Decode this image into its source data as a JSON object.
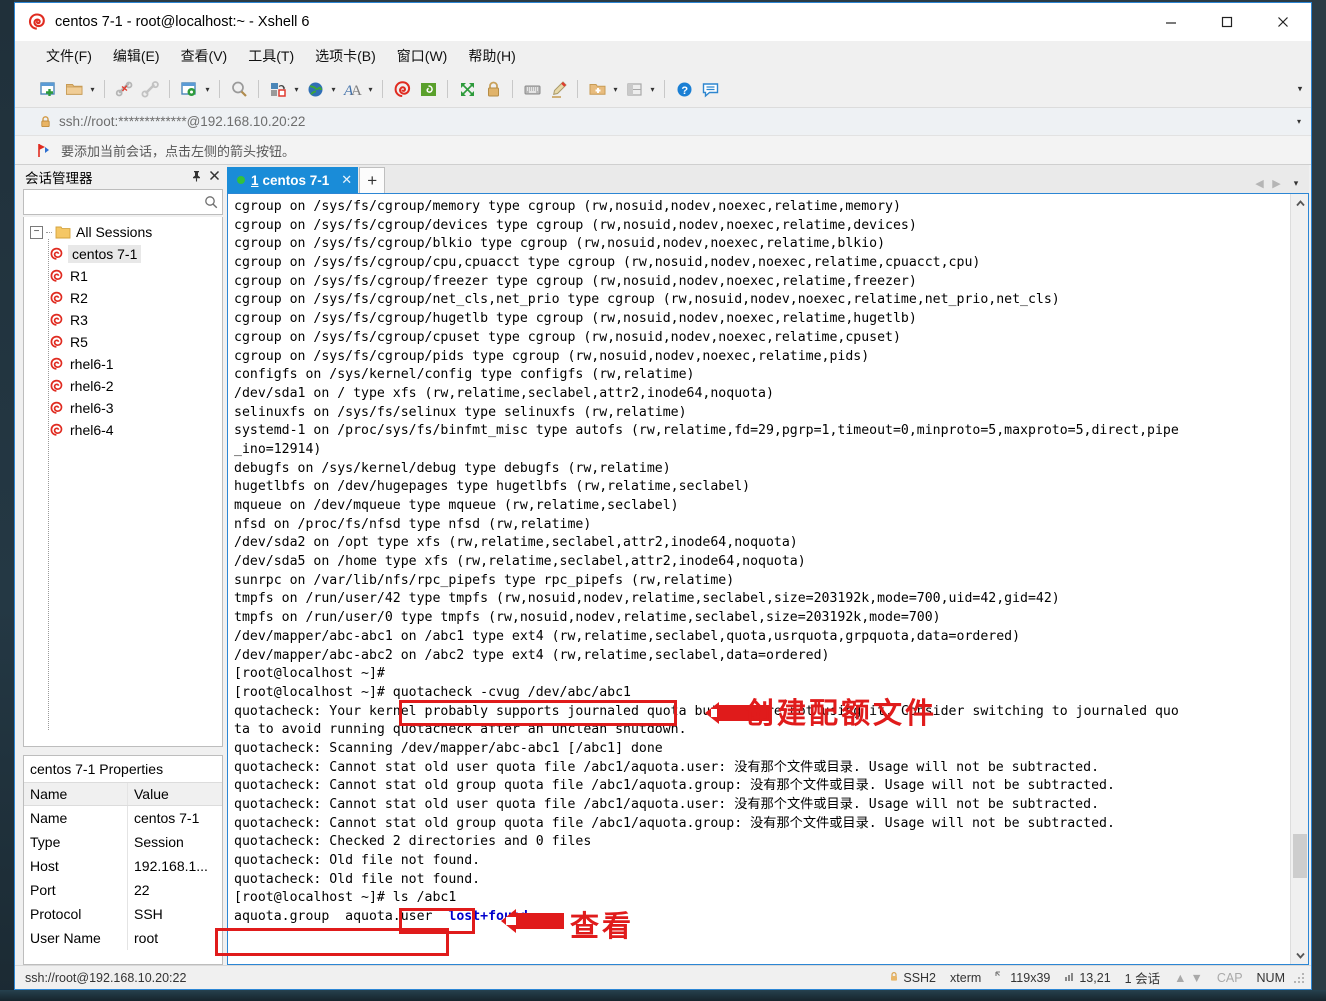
{
  "window": {
    "title": "centos 7-1 - root@localhost:~ - Xshell 6",
    "app_icon": "xshell-logo-icon",
    "minimize": "—",
    "maximize": "☐",
    "close": "✕"
  },
  "menubar": {
    "items": [
      {
        "label": "文件(F)",
        "name": "menu-file"
      },
      {
        "label": "编辑(E)",
        "name": "menu-edit"
      },
      {
        "label": "查看(V)",
        "name": "menu-view"
      },
      {
        "label": "工具(T)",
        "name": "menu-tools"
      },
      {
        "label": "选项卡(B)",
        "name": "menu-tabs"
      },
      {
        "label": "窗口(W)",
        "name": "menu-window"
      },
      {
        "label": "帮助(H)",
        "name": "menu-help"
      }
    ]
  },
  "toolbar": {
    "overflow_caret": "▾",
    "buttons": [
      {
        "name": "new-session-icon",
        "caret": false
      },
      {
        "name": "open-folder-icon",
        "caret": true
      },
      {
        "name": "disconnect-icon",
        "caret": false
      },
      {
        "name": "reconnect-icon",
        "caret": false
      },
      {
        "name": "session-properties-icon",
        "caret": true
      },
      {
        "name": "find-icon",
        "caret": false
      },
      {
        "name": "file-transfer-icon",
        "caret": true
      },
      {
        "name": "globe-icon",
        "caret": true
      },
      {
        "name": "font-icon",
        "caret": true
      },
      {
        "name": "xshell-icon",
        "caret": false
      },
      {
        "name": "xftp-icon",
        "caret": false
      },
      {
        "name": "fullscreen-icon",
        "caret": false
      },
      {
        "name": "lock-icon",
        "caret": false
      },
      {
        "name": "keyboard-icon",
        "caret": false
      },
      {
        "name": "highlight-pen-icon",
        "caret": false
      },
      {
        "name": "add-to-folder-icon",
        "caret": true
      },
      {
        "name": "arrange-layout-icon",
        "caret": true
      },
      {
        "name": "help-icon",
        "caret": false
      },
      {
        "name": "feedback-icon",
        "caret": false
      }
    ]
  },
  "addressbar": {
    "lock_icon": "lock-icon",
    "value": "ssh://root:*************@192.168.10.20:22",
    "caret": "▾"
  },
  "notifybar": {
    "icon": "bookmark-flag-icon",
    "text": "要添加当前会话，点击左侧的箭头按钮。"
  },
  "sidebar": {
    "title": "会话管理器",
    "pin_icon": "pin-icon",
    "close_icon": "close-icon",
    "search": {
      "value": "",
      "placeholder": "",
      "icon": "search-icon"
    },
    "root": {
      "label": "All Sessions",
      "expander": "−",
      "icon": "folder-icon"
    },
    "sessions": [
      {
        "label": "centos 7-1",
        "icon": "session-icon",
        "selected": true
      },
      {
        "label": "R1",
        "icon": "session-icon",
        "selected": false
      },
      {
        "label": "R2",
        "icon": "session-icon",
        "selected": false
      },
      {
        "label": "R3",
        "icon": "session-icon",
        "selected": false
      },
      {
        "label": "R5",
        "icon": "session-icon",
        "selected": false
      },
      {
        "label": "rhel6-1",
        "icon": "session-icon",
        "selected": false
      },
      {
        "label": "rhel6-2",
        "icon": "session-icon",
        "selected": false
      },
      {
        "label": "rhel6-3",
        "icon": "session-icon",
        "selected": false
      },
      {
        "label": "rhel6-4",
        "icon": "session-icon",
        "selected": false
      }
    ]
  },
  "properties": {
    "title": "centos 7-1 Properties",
    "headers": [
      "Name",
      "Value"
    ],
    "rows": [
      {
        "name": "Name",
        "value": "centos 7-1"
      },
      {
        "name": "Type",
        "value": "Session"
      },
      {
        "name": "Host",
        "value": "192.168.1..."
      },
      {
        "name": "Port",
        "value": "22"
      },
      {
        "name": "Protocol",
        "value": "SSH"
      },
      {
        "name": "User Name",
        "value": "root"
      }
    ]
  },
  "tabs": {
    "items": [
      {
        "number": "1",
        "label": "centos 7-1",
        "close": "✕",
        "status_dot": "#33c13d",
        "active": true
      }
    ],
    "add_label": "+",
    "nav_prev": "◀",
    "nav_next": "▶",
    "nav_menu": "▾"
  },
  "terminal": {
    "lines": [
      "cgroup on /sys/fs/cgroup/memory type cgroup (rw,nosuid,nodev,noexec,relatime,memory)",
      "cgroup on /sys/fs/cgroup/devices type cgroup (rw,nosuid,nodev,noexec,relatime,devices)",
      "cgroup on /sys/fs/cgroup/blkio type cgroup (rw,nosuid,nodev,noexec,relatime,blkio)",
      "cgroup on /sys/fs/cgroup/cpu,cpuacct type cgroup (rw,nosuid,nodev,noexec,relatime,cpuacct,cpu)",
      "cgroup on /sys/fs/cgroup/freezer type cgroup (rw,nosuid,nodev,noexec,relatime,freezer)",
      "cgroup on /sys/fs/cgroup/net_cls,net_prio type cgroup (rw,nosuid,nodev,noexec,relatime,net_prio,net_cls)",
      "cgroup on /sys/fs/cgroup/hugetlb type cgroup (rw,nosuid,nodev,noexec,relatime,hugetlb)",
      "cgroup on /sys/fs/cgroup/cpuset type cgroup (rw,nosuid,nodev,noexec,relatime,cpuset)",
      "cgroup on /sys/fs/cgroup/pids type cgroup (rw,nosuid,nodev,noexec,relatime,pids)",
      "configfs on /sys/kernel/config type configfs (rw,relatime)",
      "/dev/sda1 on / type xfs (rw,relatime,seclabel,attr2,inode64,noquota)",
      "selinuxfs on /sys/fs/selinux type selinuxfs (rw,relatime)",
      "systemd-1 on /proc/sys/fs/binfmt_misc type autofs (rw,relatime,fd=29,pgrp=1,timeout=0,minproto=5,maxproto=5,direct,pipe",
      "_ino=12914)",
      "debugfs on /sys/kernel/debug type debugfs (rw,relatime)",
      "hugetlbfs on /dev/hugepages type hugetlbfs (rw,relatime,seclabel)",
      "mqueue on /dev/mqueue type mqueue (rw,relatime,seclabel)",
      "nfsd on /proc/fs/nfsd type nfsd (rw,relatime)",
      "/dev/sda2 on /opt type xfs (rw,relatime,seclabel,attr2,inode64,noquota)",
      "/dev/sda5 on /home type xfs (rw,relatime,seclabel,attr2,inode64,noquota)",
      "sunrpc on /var/lib/nfs/rpc_pipefs type rpc_pipefs (rw,relatime)",
      "tmpfs on /run/user/42 type tmpfs (rw,nosuid,nodev,relatime,seclabel,size=203192k,mode=700,uid=42,gid=42)",
      "tmpfs on /run/user/0 type tmpfs (rw,nosuid,nodev,relatime,seclabel,size=203192k,mode=700)",
      "/dev/mapper/abc-abc1 on /abc1 type ext4 (rw,relatime,seclabel,quota,usrquota,grpquota,data=ordered)",
      "/dev/mapper/abc-abc2 on /abc2 type ext4 (rw,relatime,seclabel,data=ordered)",
      "[root@localhost ~]#",
      "[root@localhost ~]# quotacheck -cvug /dev/abc/abc1",
      "quotacheck: Your kernel probably supports journaled quota but you are not using it. Consider switching to journaled quo",
      "ta to avoid running quotacheck after an unclean shutdown.",
      "quotacheck: Scanning /dev/mapper/abc-abc1 [/abc1] done",
      "quotacheck: Cannot stat old user quota file /abc1/aquota.user: 没有那个文件或目录. Usage will not be subtracted.",
      "quotacheck: Cannot stat old group quota file /abc1/aquota.group: 没有那个文件或目录. Usage will not be subtracted.",
      "quotacheck: Cannot stat old user quota file /abc1/aquota.user: 没有那个文件或目录. Usage will not be subtracted.",
      "quotacheck: Cannot stat old group quota file /abc1/aquota.group: 没有那个文件或目录. Usage will not be subtracted.",
      "quotacheck: Checked 2 directories and 0 files",
      "quotacheck: Old file not found.",
      "quotacheck: Old file not found.",
      "[root@localhost ~]# ls /abc1"
    ],
    "last_line": {
      "plain": "aquota.group  aquota.user  ",
      "highlight": "lost+found",
      "highlight_color": "#0000cc"
    },
    "prompt": "[root@localhost ~]#",
    "command_1": "quotacheck -cvug /dev/abc/abc1",
    "command_2": "ls /abc1"
  },
  "annotations": {
    "color": "#e01b1b",
    "items": [
      {
        "text": "创建配额文件",
        "name": "annotation-create-quota-file"
      },
      {
        "text": "查看",
        "name": "annotation-view"
      }
    ]
  },
  "statusbar": {
    "connection": "ssh://root@192.168.10.20:22",
    "protocol": "SSH2",
    "term_type": "xterm",
    "size": "119x39",
    "cursor": "13,21",
    "sessions": "1 会话",
    "caps": "CAP",
    "num": "NUM",
    "lock_icon": "lock-icon",
    "size_icon": "resize-icon",
    "cursor_icon": "cursor-icon",
    "up_arrow": "▲",
    "down_arrow": "▼"
  }
}
